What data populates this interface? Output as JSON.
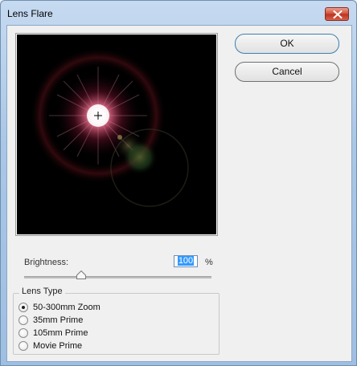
{
  "window": {
    "title": "Lens Flare"
  },
  "buttons": {
    "ok": "OK",
    "cancel": "Cancel"
  },
  "brightness": {
    "label": "Brightness:",
    "value": "100",
    "unit": "%"
  },
  "lens_type": {
    "title": "Lens Type",
    "options": [
      "50-300mm Zoom",
      "35mm Prime",
      "105mm Prime",
      "Movie Prime"
    ],
    "selected": "50-300mm Zoom"
  },
  "icons": {
    "close": "close-icon",
    "center": "crosshair-icon",
    "slider": "slider-thumb-icon"
  }
}
